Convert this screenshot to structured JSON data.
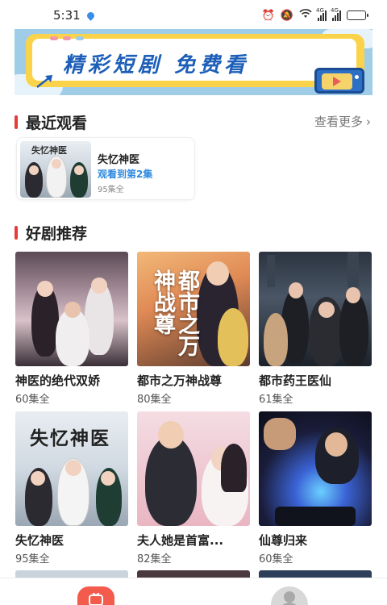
{
  "status_bar": {
    "time": "5:31",
    "network_1": "4G",
    "network_2": "4G",
    "battery_level": 0.8
  },
  "banner": {
    "title": "精彩短剧  免费看",
    "colors": {
      "background": "#9fcde8",
      "frame": "#fbd34a",
      "text": "#1d5fb8"
    }
  },
  "recent": {
    "section_title": "最近观看",
    "see_more": "查看更多",
    "item": {
      "poster_text": "失忆神医",
      "name": "失忆神医",
      "progress": "观看到第2集",
      "episodes": "95集全"
    }
  },
  "recommend": {
    "section_title": "好剧推荐",
    "items": [
      {
        "name": "神医的绝代双娇",
        "episodes": "60集全",
        "poster_text": ""
      },
      {
        "name": "都市之万神战尊",
        "episodes": "80集全",
        "poster_text": "都市之万神战尊"
      },
      {
        "name": "都市药王医仙",
        "episodes": "61集全",
        "poster_text": ""
      },
      {
        "name": "失忆神医",
        "episodes": "95集全",
        "poster_text": "失忆神医"
      },
      {
        "name": "夫人她是首富...",
        "episodes": "82集全",
        "poster_text": ""
      },
      {
        "name": "仙尊归来",
        "episodes": "60集全",
        "poster_text": ""
      }
    ]
  },
  "tab_bar": {
    "items": [
      {
        "icon": "home-play-icon",
        "active": true
      },
      {
        "icon": "profile-icon",
        "active": false
      }
    ],
    "accent": "#f35b4d"
  }
}
